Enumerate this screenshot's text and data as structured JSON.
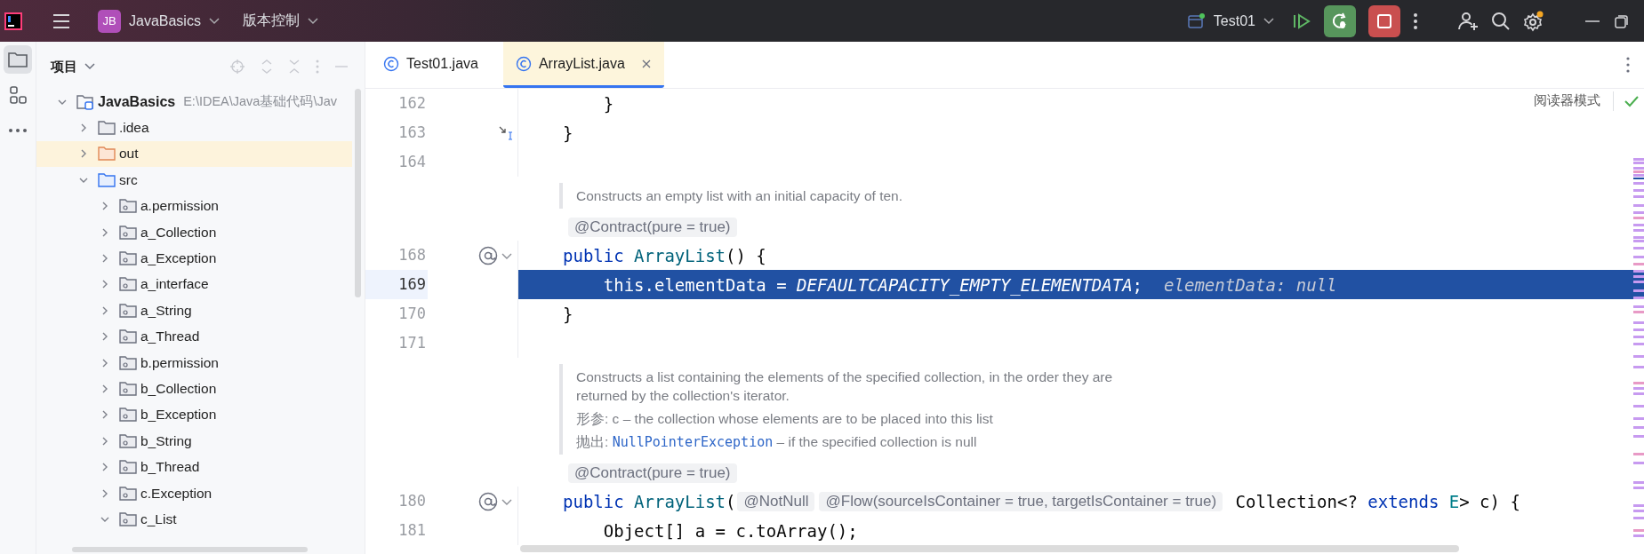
{
  "title_bar": {
    "project_badge": "JB",
    "project": "JavaBasics",
    "vcs": "版本控制",
    "run_config": "Test01"
  },
  "left_stripe": [
    {
      "kind": "project",
      "selected": true
    },
    {
      "kind": "structure",
      "selected": false
    },
    {
      "kind": "more",
      "selected": false
    }
  ],
  "tool_window": {
    "title": "项目"
  },
  "tree": [
    {
      "label": "JavaBasics",
      "path": "E:\\IDEA\\Java基础代码\\Jav",
      "kind": "module",
      "expanded": true,
      "highlighted": false,
      "children": [
        {
          "label": ".idea",
          "kind": "folder",
          "expanded": false,
          "highlighted": false
        },
        {
          "label": "out",
          "kind": "excluded",
          "expanded": false,
          "highlighted": true
        },
        {
          "label": "src",
          "kind": "source",
          "expanded": true,
          "highlighted": false,
          "children": [
            {
              "label": "a.permission",
              "kind": "package",
              "expanded": false,
              "highlighted": false
            },
            {
              "label": "a_Collection",
              "kind": "package",
              "expanded": false,
              "highlighted": false
            },
            {
              "label": "a_Exception",
              "kind": "package",
              "expanded": false,
              "highlighted": false
            },
            {
              "label": "a_interface",
              "kind": "package",
              "expanded": false,
              "highlighted": false
            },
            {
              "label": "a_String",
              "kind": "package",
              "expanded": false,
              "highlighted": false
            },
            {
              "label": "a_Thread",
              "kind": "package",
              "expanded": false,
              "highlighted": false
            },
            {
              "label": "b.permission",
              "kind": "package",
              "expanded": false,
              "highlighted": false
            },
            {
              "label": "b_Collection",
              "kind": "package",
              "expanded": false,
              "highlighted": false
            },
            {
              "label": "b_Exception",
              "kind": "package",
              "expanded": false,
              "highlighted": false
            },
            {
              "label": "b_String",
              "kind": "package",
              "expanded": false,
              "highlighted": false
            },
            {
              "label": "b_Thread",
              "kind": "package",
              "expanded": false,
              "highlighted": false
            },
            {
              "label": "c.Exception",
              "kind": "package",
              "expanded": false,
              "highlighted": false
            },
            {
              "label": "c_List",
              "kind": "package",
              "expanded": true,
              "highlighted": false
            }
          ]
        }
      ]
    }
  ],
  "tabs": [
    {
      "label": "Test01.java",
      "selected": false
    },
    {
      "label": "ArrayList.java",
      "selected": true
    }
  ],
  "reader_mode": "阅读器模式",
  "editor_lines": [
    {
      "kind": "code",
      "number": "162",
      "selected": false,
      "tokens": [
        {
          "kind": "plain",
          "text": "    }"
        }
      ]
    },
    {
      "kind": "code",
      "number": "163",
      "selected": false,
      "gutter": {
        "kind": "fold"
      },
      "tokens": [
        {
          "kind": "plain",
          "text": "}"
        }
      ]
    },
    {
      "kind": "code",
      "number": "164",
      "selected": false
    },
    {
      "kind": "doc",
      "paragraphs": [
        [
          {
            "kind": "text",
            "text": "Constructs an empty list with an initial capacity of ten."
          }
        ]
      ]
    },
    {
      "kind": "inlay",
      "text": "@Contract(pure = true)"
    },
    {
      "kind": "code",
      "number": "168",
      "selected": false,
      "gutter": {
        "kind": "annotation"
      },
      "tokens": [
        {
          "kind": "keyword",
          "text": "public "
        },
        {
          "kind": "declaration",
          "text": "ArrayList"
        },
        {
          "kind": "plain",
          "text": "() {"
        }
      ]
    },
    {
      "kind": "code",
      "number": "169",
      "selected": true,
      "tokens": [
        {
          "kind": "plain",
          "text": "    this.elementData = "
        },
        {
          "kind": "constant",
          "text": "DEFAULTCAPACITY_EMPTY_ELEMENTDATA"
        },
        {
          "kind": "plain",
          "text": ";"
        },
        {
          "kind": "hint",
          "text": "elementData: null"
        }
      ]
    },
    {
      "kind": "code",
      "number": "170",
      "selected": false,
      "tokens": [
        {
          "kind": "plain",
          "text": "}"
        }
      ]
    },
    {
      "kind": "code",
      "number": "171",
      "selected": false
    },
    {
      "kind": "doc",
      "paragraphs": [
        [
          {
            "kind": "text",
            "text": "Constructs a list containing the elements of the specified collection, in the order they are returned by the collection's iterator."
          }
        ],
        [
          {
            "kind": "text",
            "text": "形参: c – the collection whose elements are to be placed into this list"
          }
        ],
        [
          {
            "kind": "text",
            "text": "抛出: "
          },
          {
            "kind": "code",
            "text": "NullPointerException"
          },
          {
            "kind": "text",
            "text": " – if the specified collection is null"
          }
        ]
      ]
    },
    {
      "kind": "inlay",
      "text": "@Contract(pure = true)"
    },
    {
      "kind": "code",
      "number": "180",
      "selected": false,
      "gutter": {
        "kind": "annotation"
      },
      "tokens": [
        {
          "kind": "keyword",
          "text": "public "
        },
        {
          "kind": "declaration",
          "text": "ArrayList"
        },
        {
          "kind": "plain",
          "text": "("
        },
        {
          "kind": "inlay",
          "text": "@NotNull"
        },
        {
          "kind": "inlay",
          "text": "@Flow(sourceIsContainer = true, targetIsContainer = true)"
        },
        {
          "kind": "plain",
          "text": " Collection<? "
        },
        {
          "kind": "keyword",
          "text": "extends "
        },
        {
          "kind": "typeparam",
          "text": "E"
        },
        {
          "kind": "plain",
          "text": "> c) {"
        }
      ]
    },
    {
      "kind": "code",
      "number": "181",
      "selected": false,
      "tokens": [
        {
          "kind": "plain",
          "text": "    Object[] a = c.toArray();"
        }
      ]
    }
  ]
}
